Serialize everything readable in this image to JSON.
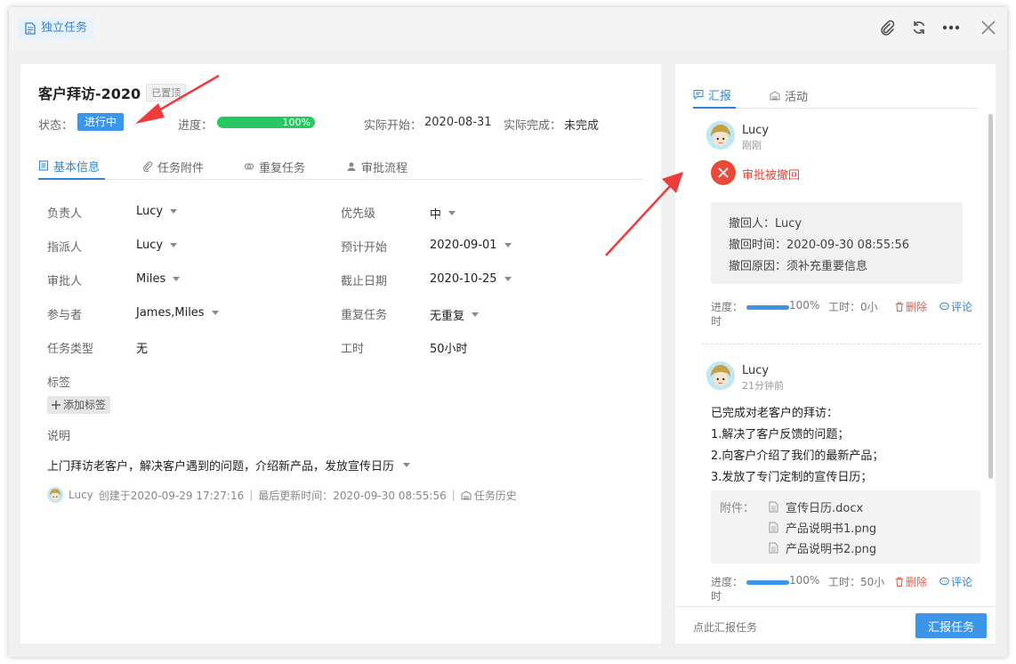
{
  "header": {
    "task_type_label": "独立任务",
    "icons": [
      "paperclip-icon",
      "refresh-icon",
      "more-icon",
      "close-icon"
    ]
  },
  "task": {
    "title": "客户拜访-2020",
    "pinned_badge": "已置顶",
    "status_label": "状态：",
    "status_value": "进行中",
    "progress_label": "进度：",
    "progress_text": "100%",
    "progress_fraction": 1.0,
    "actual_start_label": "实际开始：",
    "actual_start_value": "2020-08-31",
    "actual_finish_label": "实际完成：",
    "actual_finish_value": "未完成"
  },
  "tabs": [
    {
      "label": "基本信息",
      "active": true
    },
    {
      "label": "任务附件",
      "active": false
    },
    {
      "label": "重复任务",
      "active": false
    },
    {
      "label": "审批流程",
      "active": false
    }
  ],
  "fields": {
    "owner_label": "负责人",
    "owner_value": "Lucy",
    "assigner_label": "指派人",
    "assigner_value": "Lucy",
    "approver_label": "审批人",
    "approver_value": "Miles",
    "participants_label": "参与者",
    "participants_value": "James,Miles",
    "type_label": "任务类型",
    "type_value": "无",
    "priority_label": "优先级",
    "priority_value": "中",
    "plan_start_label": "预计开始",
    "plan_start_value": "2020-09-01",
    "deadline_label": "截止日期",
    "deadline_value": "2020-10-25",
    "repeat_label": "重复任务",
    "repeat_value": "无重复",
    "hours_label": "工时",
    "hours_value": "50小时"
  },
  "tags": {
    "label": "标签",
    "add_button": "添加标签"
  },
  "description": {
    "label": "说明",
    "text": "上门拜访老客户，解决客户遇到的问题，介绍新产品，发放宣传日历"
  },
  "meta": {
    "user": "Lucy",
    "created": "创建于2020-09-29 17:27:16",
    "updated": "最后更新时间：2020-09-30 08:55:56",
    "history": "任务历史",
    "separator": "|"
  },
  "right_tabs": [
    {
      "label": "汇报",
      "active": true
    },
    {
      "label": "活动",
      "active": false
    }
  ],
  "entries": [
    {
      "user": "Lucy",
      "time": "刚刚",
      "status_text": "审批被撤回",
      "details": [
        "撤回人：Lucy",
        "撤回时间：2020-09-30 08:55:56",
        "撤回原因：须补充重要信息"
      ],
      "progress_label": "进度：",
      "progress_text": "100%",
      "hours_text": "工时：0小",
      "hours_wrap": "时",
      "delete_label": "删除",
      "comment_label": "评论"
    },
    {
      "user": "Lucy",
      "time": "21分钟前",
      "lines": [
        "已完成对老客户的拜访：",
        "1.解决了客户反馈的问题；",
        "2.向客户介绍了我们的最新产品；",
        "3.发放了专门定制的宣传日历；"
      ],
      "attachments_label": "附件：",
      "attachments": [
        "宣传日历.docx",
        "产品说明书1.png",
        "产品说明书2.png"
      ],
      "progress_label": "进度：",
      "progress_text": "100%",
      "hours_text": "工时：50小",
      "hours_wrap": "时",
      "delete_label": "删除",
      "comment_label": "评论"
    }
  ],
  "footer": {
    "hint": "点此汇报任务",
    "button": "汇报任务"
  },
  "colors": {
    "accent": "#3d95ea",
    "progress_green": "#26c861",
    "danger": "#ea4a3a",
    "annotation_arrow": "#ee3b3b"
  }
}
